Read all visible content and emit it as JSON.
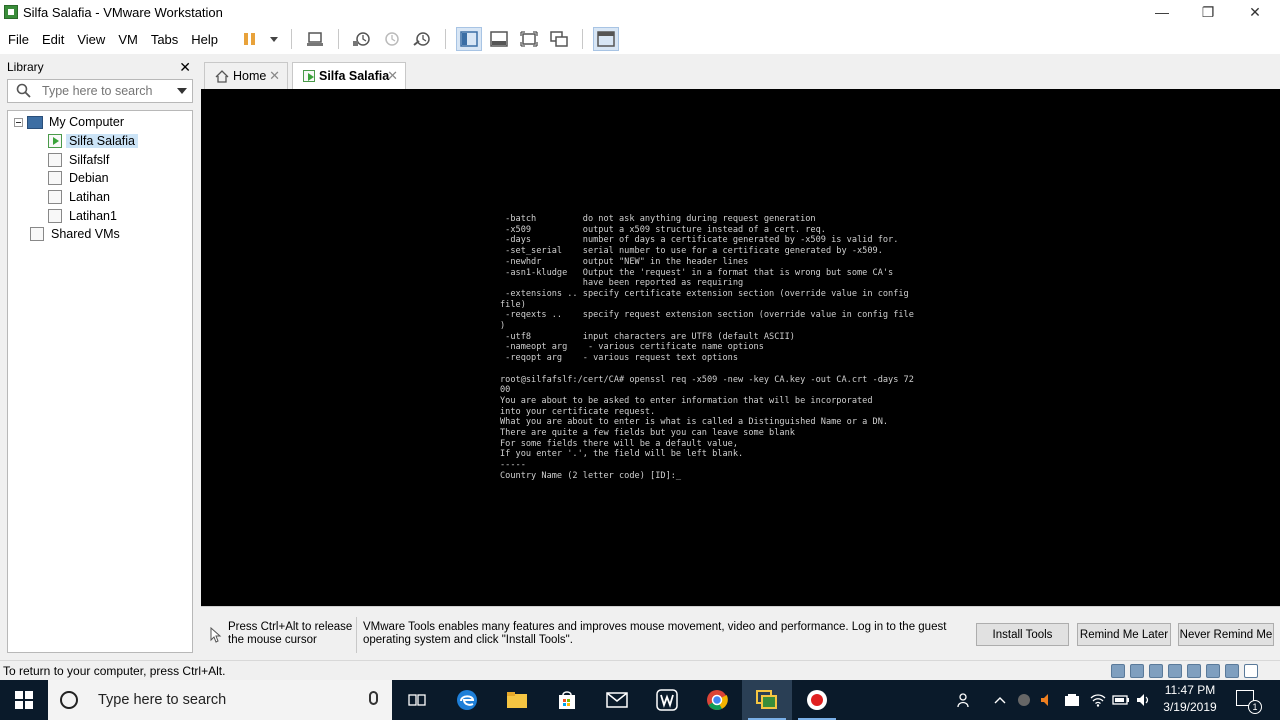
{
  "window": {
    "title": "Silfa Salafia - VMware Workstation",
    "minimize_glyph": "—",
    "maximize_glyph": "❐",
    "close_glyph": "✕"
  },
  "menu": [
    "File",
    "Edit",
    "View",
    "VM",
    "Tabs",
    "Help"
  ],
  "toolbar_icons": [
    "pause-icon",
    "dropdown-arrow-icon",
    "send-ctrl-alt-del-icon",
    "snapshot-icon",
    "revert-snapshot-icon",
    "snapshot-manager-icon",
    "show-library-icon",
    "thumbnail-bar-icon",
    "full-screen-icon",
    "unity-icon",
    "console-view-icon"
  ],
  "library": {
    "title": "Library",
    "close_glyph": "✕",
    "search_placeholder": "Type here to search",
    "tree": {
      "root": "My Computer",
      "vms": [
        "Silfa Salafia",
        "Silfafslf",
        "Debian",
        "Latihan",
        "Latihan1"
      ],
      "selected": "Silfa Salafia",
      "shared": "Shared VMs"
    }
  },
  "tabs": [
    {
      "label": "Home",
      "active": false
    },
    {
      "label": "Silfa Salafia",
      "active": true
    }
  ],
  "terminal": {
    "lines": [
      " -batch         do not ask anything during request generation",
      " -x509          output a x509 structure instead of a cert. req.",
      " -days          number of days a certificate generated by -x509 is valid for.",
      " -set_serial    serial number to use for a certificate generated by -x509.",
      " -newhdr        output \"NEW\" in the header lines",
      " -asn1-kludge   Output the 'request' in a format that is wrong but some CA's",
      "                have been reported as requiring",
      " -extensions .. specify certificate extension section (override value in config",
      "file)",
      " -reqexts ..    specify request extension section (override value in config file",
      ")",
      " -utf8          input characters are UTF8 (default ASCII)",
      " -nameopt arg    - various certificate name options",
      " -reqopt arg    - various request text options",
      "",
      "root@silfafslf:/cert/CA# openssl req -x509 -new -key CA.key -out CA.crt -days 72",
      "00",
      "You are about to be asked to enter information that will be incorporated",
      "into your certificate request.",
      "What you are about to enter is what is called a Distinguished Name or a DN.",
      "There are quite a few fields but you can leave some blank",
      "For some fields there will be a default value,",
      "If you enter '.', the field will be left blank.",
      "-----",
      "Country Name (2 letter code) [ID]:_"
    ]
  },
  "banner": {
    "release_text": "Press Ctrl+Alt to release the mouse cursor",
    "message": "VMware Tools enables many features and improves mouse movement, video and performance. Log in to the guest operating system and click \"Install Tools\".",
    "buttons": {
      "install": "Install Tools",
      "remind": "Remind Me Later",
      "never": "Never Remind Me"
    }
  },
  "statusbar": {
    "text": "To return to your computer, press Ctrl+Alt."
  },
  "taskbar": {
    "search_text": "Type here to search",
    "time": "11:47 PM",
    "date": "3/19/2019",
    "notification_count": "1",
    "apps": [
      "task-view-icon",
      "edge-icon",
      "file-explorer-icon",
      "store-icon",
      "mail-icon",
      "wattpad-icon",
      "chrome-icon",
      "vmware-icon",
      "recorder-icon"
    ]
  },
  "colors": {
    "accent": "#0078d7",
    "console_bg": "#000000",
    "terminal_text": "#cfcfcf",
    "taskbar_bg": "#0a1a2a",
    "tree_selected": "#cce4f7"
  }
}
